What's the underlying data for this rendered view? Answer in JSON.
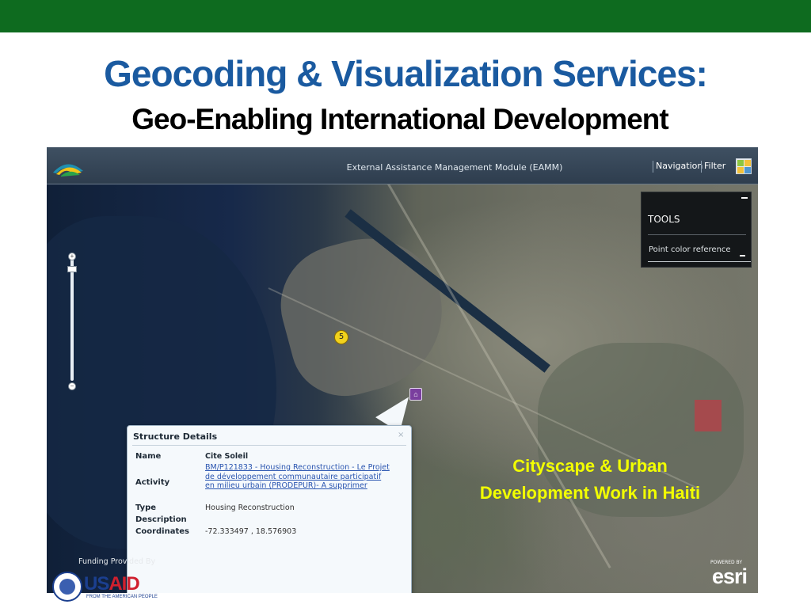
{
  "slide": {
    "title": "Geocoding & Visualization Services:",
    "subtitle": "Geo-Enabling International Development",
    "colors": {
      "banner": "#0e6b1f",
      "title": "#1a5aa0",
      "annotation": "#f2ff00"
    }
  },
  "app": {
    "title": "External Assistance Management Module (EAMM)",
    "nav": {
      "navigation_label": "Navigation",
      "filter_label": "Filter"
    },
    "icons": {
      "logo": "eamm-logo-icon",
      "layout": "grid-icon"
    }
  },
  "map": {
    "cluster_count": "5",
    "tools": {
      "title": "TOOLS",
      "item": "Point color reference"
    },
    "structure_details": {
      "title": "Structure Details",
      "close": "×",
      "fields": [
        {
          "label": "Name",
          "value": "Cite Soleil"
        },
        {
          "label": "Activity",
          "value": "BM/P121833 - Housing Reconstruction - Le Projet de développement communautaire participatif en milieu urbain (PRODEPUR)- A supprimer"
        },
        {
          "label": "Type",
          "value": "Housing Reconstruction"
        },
        {
          "label": "Description",
          "value": ""
        },
        {
          "label": "Coordinates",
          "value": "-72.333497 , 18.576903"
        }
      ]
    },
    "funding_text": "Funding Provided By",
    "annotation_line1": "Cityscape & Urban",
    "annotation_line2": "Development Work in Haiti",
    "esri": {
      "small": "POWERED BY",
      "big": "esri"
    }
  },
  "footer": {
    "usaid_us": "US",
    "usaid_aid": "AID",
    "usaid_tagline": "FROM THE AMERICAN PEOPLE"
  }
}
